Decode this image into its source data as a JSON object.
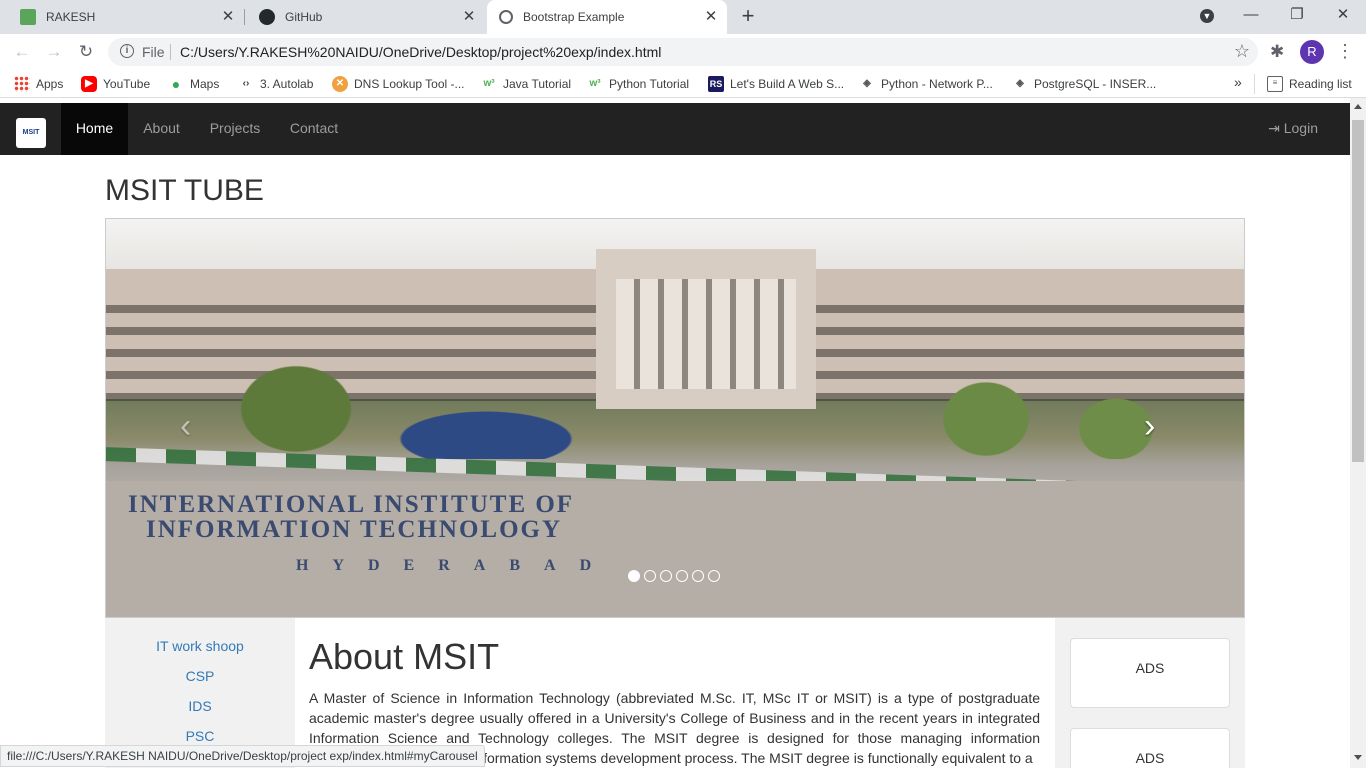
{
  "browser": {
    "tabs": [
      {
        "title": "RAKESH",
        "icon": "spreadsheet-icon",
        "active": false
      },
      {
        "title": "GitHub",
        "icon": "github-icon",
        "active": false
      },
      {
        "title": "Bootstrap Example",
        "icon": "globe-icon",
        "active": true
      }
    ],
    "address": {
      "scheme_label": "File",
      "url": "C:/Users/Y.RAKESH%20NAIDU/OneDrive/Desktop/project%20exp/index.html"
    },
    "avatar_letter": "R",
    "bookmarks": [
      {
        "label": "Apps",
        "icon": "apps-grid-icon"
      },
      {
        "label": "YouTube",
        "icon": "youtube-icon"
      },
      {
        "label": "Maps",
        "icon": "maps-pin-icon"
      },
      {
        "label": "3. Autolab",
        "icon": "code-brackets-icon"
      },
      {
        "label": "DNS Lookup Tool -...",
        "icon": "dns-tool-icon"
      },
      {
        "label": "Java Tutorial",
        "icon": "w3schools-icon"
      },
      {
        "label": "Python Tutorial",
        "icon": "w3schools-icon"
      },
      {
        "label": "Let's Build A Web S...",
        "icon": "rs-icon"
      },
      {
        "label": "Python - Network P...",
        "icon": "diamond-icon"
      },
      {
        "label": "PostgreSQL - INSER...",
        "icon": "diamond-icon"
      }
    ],
    "more_bookmarks": "»",
    "reading_list": "Reading list",
    "status_url": "file:///C:/Users/Y.RAKESH NAIDU/OneDrive/Desktop/project exp/index.html#myCarousel"
  },
  "site": {
    "brand": "MSIT",
    "nav": [
      "Home",
      "About",
      "Projects",
      "Contact"
    ],
    "active_nav": "Home",
    "login_label": "Login",
    "title": "MSIT TUBE",
    "carousel": {
      "caption_line1": "INTERNATIONAL INSTITUTE OF",
      "caption_line2": "INFORMATION TECHNOLOGY",
      "caption_line3": "HYDERABAD",
      "slide_count": 6,
      "active_slide": 1
    },
    "left_links": [
      "IT work shoop",
      "CSP",
      "IDS",
      "PSC"
    ],
    "about_heading": "About MSIT",
    "about_text": "A Master of Science in Information Technology (abbreviated M.Sc. IT, MSc IT or MSIT) is a type of postgraduate academic master's degree usually offered in a University's College of Business and in the recent years in integrated Information Science and Technology colleges. The MSIT degree is designed for those managing information technology, especially the information systems development process. The MSIT degree is functionally equivalent to a",
    "ads": [
      "ADS",
      "ADS"
    ]
  }
}
